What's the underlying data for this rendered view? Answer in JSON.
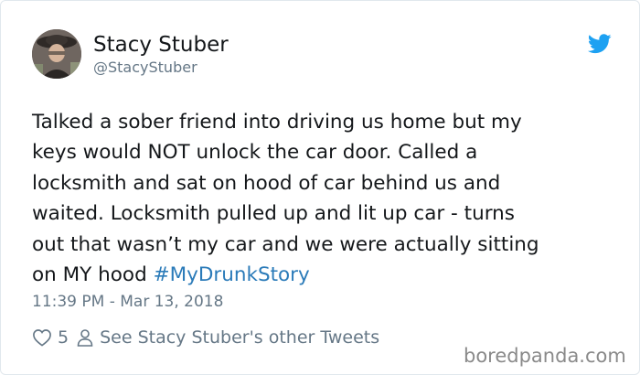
{
  "author": {
    "name": "Stacy Stuber",
    "handle": "@StacyStuber"
  },
  "tweet": {
    "text_lines": [
      "Talked a sober friend into driving us home but my",
      "keys would NOT unlock the car door.  Called  a",
      "locksmith and sat on hood of car behind us and",
      "waited.  Locksmith pulled up and lit up car - turns",
      "out that wasn’t my car and we were actually sitting",
      "on MY hood "
    ],
    "hashtag": "#MyDrunkStory",
    "timestamp": "11:39 PM - Mar 13, 2018"
  },
  "actions": {
    "like_count": "5",
    "other_tweets_label": "See Stacy Stuber's other Tweets"
  },
  "icons": {
    "bird": "twitter-bird-icon",
    "heart": "heart-icon",
    "person": "person-icon"
  },
  "colors": {
    "text": "#14171a",
    "muted": "#657786",
    "link": "#2b7bb9",
    "twitter_blue": "#1da1f2"
  },
  "watermark": "boredpanda.com"
}
